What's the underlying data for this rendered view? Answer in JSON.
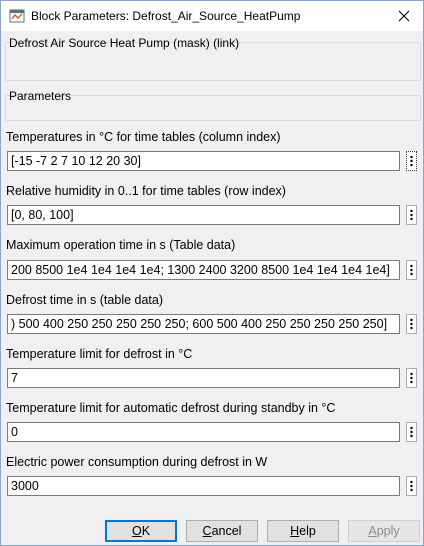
{
  "window": {
    "title": "Block Parameters: Defrost_Air_Source_HeatPump"
  },
  "description_group": {
    "title": "Defrost Air Source Heat Pump (mask) (link)"
  },
  "parameters_group": {
    "title": "Parameters"
  },
  "fields": [
    {
      "label": "Temperatures in °C for time tables (column index)",
      "value": "[-15 -7 2 7 10 12 20 30]"
    },
    {
      "label": "Relative humidity in 0..1 for  time tables (row index)",
      "value": "[0, 80, 100]"
    },
    {
      "label": "Maximum operation time in s (Table data)",
      "value": "200 8500 1e4 1e4 1e4 1e4; 1300 2400 3200 8500 1e4 1e4 1e4 1e4]"
    },
    {
      "label": "Defrost time in s (table data)",
      "value": ") 500 400 250 250 250 250 250; 600 500 400 250 250 250 250 250]"
    },
    {
      "label": "Temperature limit for defrost in °C",
      "value": "7"
    },
    {
      "label": "Temperature limit for automatic defrost during standby in °C",
      "value": "0"
    },
    {
      "label": "Electric power consumption during defrost in W",
      "value": "3000"
    }
  ],
  "buttons": {
    "ok": "OK",
    "cancel": "Cancel",
    "help": "Help",
    "apply": "Apply"
  },
  "colors": {
    "accent": "#0078d7",
    "title_bg": "#ffffff",
    "dialog_bg": "#f0f0f0"
  },
  "icons": {
    "app": "simulink-block-icon",
    "close": "close-icon",
    "more": "vertical-ellipsis-icon"
  }
}
